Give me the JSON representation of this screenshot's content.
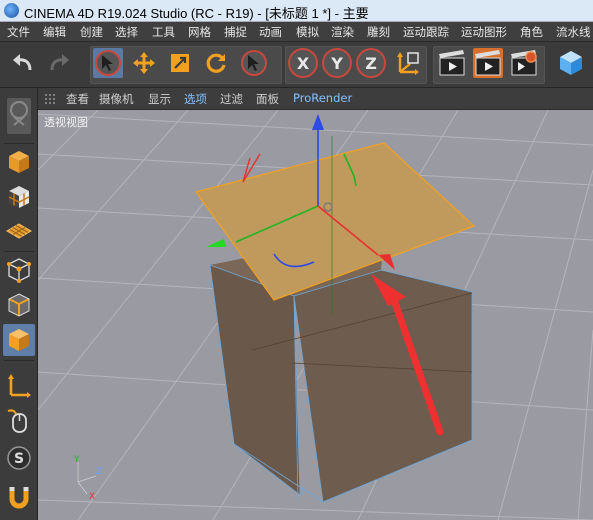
{
  "window": {
    "title": "CINEMA 4D R19.024 Studio (RC - R19) - [未标题 1 *] - 主要"
  },
  "menubar": {
    "items": [
      "文件",
      "编辑",
      "创建",
      "选择",
      "工具",
      "网格",
      "捕捉",
      "动画",
      "模拟",
      "渲染",
      "雕刻",
      "运动跟踪",
      "运动图形",
      "角色",
      "流水线"
    ]
  },
  "toolbar": {
    "axis_x": "X",
    "axis_y": "Y",
    "axis_z": "Z"
  },
  "viewport": {
    "menu": [
      "查看",
      "摄像机",
      "显示",
      "选项",
      "过滤",
      "面板",
      "ProRender"
    ],
    "label": "透视视图",
    "colors": {
      "background": "#9a9aa2",
      "grid": "#b4b4bb",
      "cube": "#6e5c4f",
      "plane": "#bf9a5c",
      "arrow": "#ee3030"
    }
  }
}
